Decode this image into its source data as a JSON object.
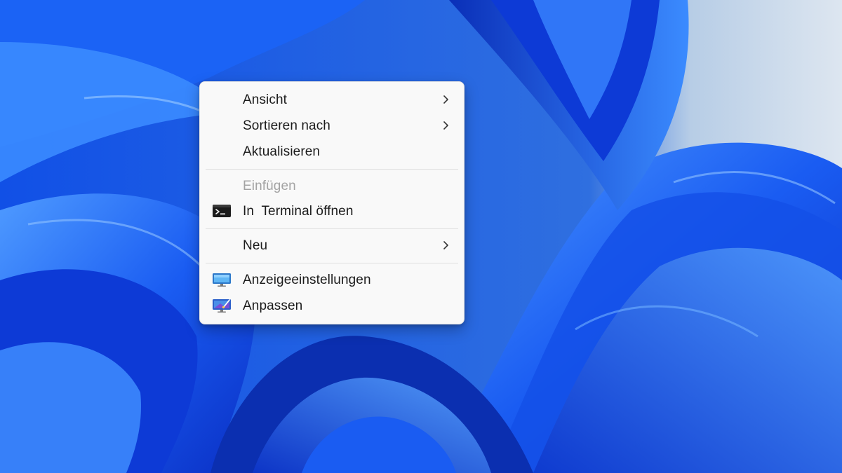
{
  "desktop": {
    "accent_colors": {
      "wallpaper_deep": "#0a2fc4",
      "wallpaper_light": "#3b8bff",
      "backdrop": "#d9e3ef"
    }
  },
  "context_menu": {
    "items": [
      {
        "label": "Ansicht",
        "has_submenu": true,
        "icon": null
      },
      {
        "label": "Sortieren nach",
        "has_submenu": true,
        "icon": null
      },
      {
        "label": "Aktualisieren",
        "has_submenu": false,
        "icon": null
      },
      {
        "label": "Einfügen",
        "has_submenu": false,
        "disabled": true,
        "icon": null
      },
      {
        "label": "In  Terminal öffnen",
        "has_submenu": false,
        "icon": "terminal-icon"
      },
      {
        "label": "Neu",
        "has_submenu": true,
        "icon": null
      },
      {
        "label": "Anzeigeeinstellungen",
        "has_submenu": false,
        "icon": "display-settings-icon"
      },
      {
        "label": "Anpassen",
        "has_submenu": false,
        "icon": "personalize-icon"
      }
    ],
    "colors": {
      "background": "#f9f9f9",
      "text": "#1c1c1c",
      "disabled_text": "#a3a3a3",
      "separator": "#e0e0e0"
    }
  }
}
